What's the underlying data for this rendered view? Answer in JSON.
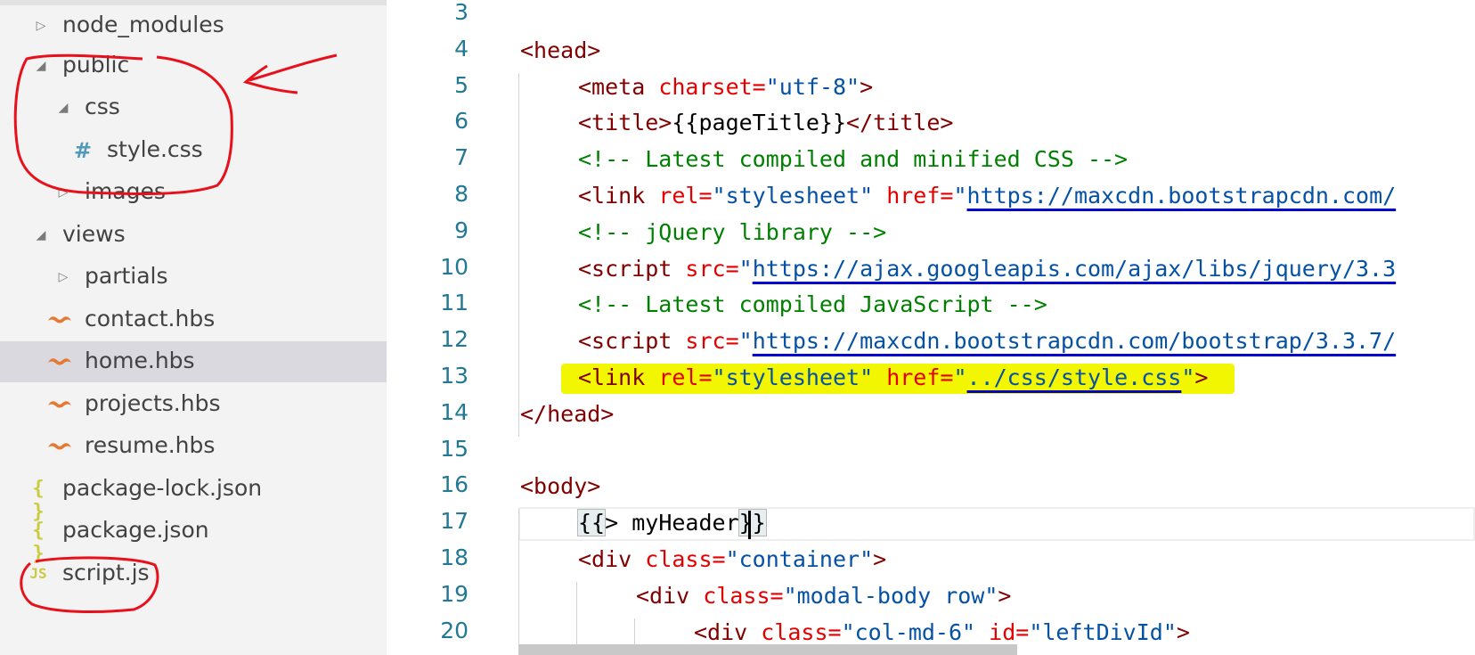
{
  "explorer": {
    "items": [
      {
        "label": "node_modules",
        "kind": "folder",
        "expanded": false
      },
      {
        "label": "public",
        "kind": "folder",
        "expanded": true
      },
      {
        "label": "css",
        "kind": "folder",
        "expanded": true
      },
      {
        "label": "style.css",
        "kind": "file",
        "icon": "hash-icon"
      },
      {
        "label": "images",
        "kind": "folder",
        "expanded": false
      },
      {
        "label": "views",
        "kind": "folder",
        "expanded": true
      },
      {
        "label": "partials",
        "kind": "folder",
        "expanded": false
      },
      {
        "label": "contact.hbs",
        "kind": "file",
        "icon": "handlebars-icon"
      },
      {
        "label": "home.hbs",
        "kind": "file",
        "icon": "handlebars-icon",
        "selected": true
      },
      {
        "label": "projects.hbs",
        "kind": "file",
        "icon": "handlebars-icon"
      },
      {
        "label": "resume.hbs",
        "kind": "file",
        "icon": "handlebars-icon"
      },
      {
        "label": "package-lock.json",
        "kind": "file",
        "icon": "json-icon"
      },
      {
        "label": "package.json",
        "kind": "file",
        "icon": "json-icon"
      },
      {
        "label": "script.js",
        "kind": "file",
        "icon": "js-icon"
      }
    ],
    "icon_glyphs": {
      "hash": "#",
      "json": "{ }",
      "js": "JS",
      "expanded": "◢",
      "collapsed": "▷"
    }
  },
  "editor": {
    "lines": [
      {
        "number": "3",
        "tokens": []
      },
      {
        "number": "4",
        "tokens": [
          [
            "tag",
            "<head>"
          ]
        ]
      },
      {
        "number": "5",
        "tokens": [
          [
            "tag",
            "<meta "
          ],
          [
            "attr",
            "charset="
          ],
          [
            "val",
            "\"utf-8\""
          ],
          [
            "tag",
            ">"
          ]
        ]
      },
      {
        "number": "6",
        "tokens": [
          [
            "tag",
            "<title>"
          ],
          [
            "txt",
            "{{pageTitle}}"
          ],
          [
            "tag",
            "</title>"
          ]
        ]
      },
      {
        "number": "7",
        "tokens": [
          [
            "cmt",
            "<!-- Latest compiled and minified CSS -->"
          ]
        ]
      },
      {
        "number": "8",
        "tokens": [
          [
            "tag",
            "<link "
          ],
          [
            "attr",
            "rel="
          ],
          [
            "val",
            "\"stylesheet\" "
          ],
          [
            "attr",
            "href="
          ],
          [
            "val",
            "\""
          ],
          [
            "link",
            "https://maxcdn.bootstrapcdn.com/"
          ]
        ]
      },
      {
        "number": "9",
        "tokens": [
          [
            "cmt",
            "<!-- jQuery library -->"
          ]
        ]
      },
      {
        "number": "10",
        "tokens": [
          [
            "tag",
            "<script "
          ],
          [
            "attr",
            "src="
          ],
          [
            "val",
            "\""
          ],
          [
            "link",
            "https://ajax.googleapis.com/ajax/libs/jquery/3.3"
          ]
        ]
      },
      {
        "number": "11",
        "tokens": [
          [
            "cmt",
            "<!-- Latest compiled JavaScript -->"
          ]
        ]
      },
      {
        "number": "12",
        "tokens": [
          [
            "tag",
            "<script "
          ],
          [
            "attr",
            "src="
          ],
          [
            "val",
            "\""
          ],
          [
            "link",
            "https://maxcdn.bootstrapcdn.com/bootstrap/3.3.7/"
          ]
        ]
      },
      {
        "number": "13",
        "tokens": [
          [
            "tag",
            "<link "
          ],
          [
            "attr",
            "rel="
          ],
          [
            "val",
            "\"stylesheet\" "
          ],
          [
            "attr",
            "href="
          ],
          [
            "val",
            "\""
          ],
          [
            "link",
            "../css/style.css"
          ],
          [
            "val",
            "\""
          ],
          [
            "tag",
            ">"
          ]
        ]
      },
      {
        "number": "14",
        "tokens": [
          [
            "tag",
            "</head>"
          ]
        ]
      },
      {
        "number": "15",
        "tokens": []
      },
      {
        "number": "16",
        "tokens": [
          [
            "tag",
            "<body>"
          ]
        ]
      },
      {
        "number": "17",
        "tokens": [
          [
            "brace",
            "{{"
          ],
          [
            "txt",
            "> myHeader"
          ],
          [
            "brace",
            "}}"
          ]
        ]
      },
      {
        "number": "18",
        "tokens": [
          [
            "tag",
            "<div "
          ],
          [
            "attr",
            "class="
          ],
          [
            "val",
            "\"container\""
          ],
          [
            "tag",
            ">"
          ]
        ]
      },
      {
        "number": "19",
        "tokens": [
          [
            "tag",
            "<div "
          ],
          [
            "attr",
            "class="
          ],
          [
            "val",
            "\"modal-body row\""
          ],
          [
            "tag",
            ">"
          ]
        ]
      },
      {
        "number": "20",
        "tokens": [
          [
            "tag",
            "<div "
          ],
          [
            "attr",
            "class="
          ],
          [
            "val",
            "\"col-md-6\" "
          ],
          [
            "attr",
            "id="
          ],
          [
            "val",
            "\"leftDivId\""
          ],
          [
            "tag",
            ">"
          ]
        ]
      }
    ],
    "indents": [
      0,
      0,
      1,
      1,
      1,
      1,
      1,
      1,
      1,
      1,
      1,
      0,
      0,
      0,
      1,
      1,
      2,
      3
    ]
  },
  "colors": {
    "sidebar_bg": "#f3f3f3",
    "selected_row": "#d9d9df",
    "highlighter": "#f2f600",
    "annotation_red": "#e8101a",
    "tag": "#800000",
    "attribute": "#e50000",
    "string": "#0451a5",
    "comment": "#008000",
    "line_number": "#237893"
  }
}
